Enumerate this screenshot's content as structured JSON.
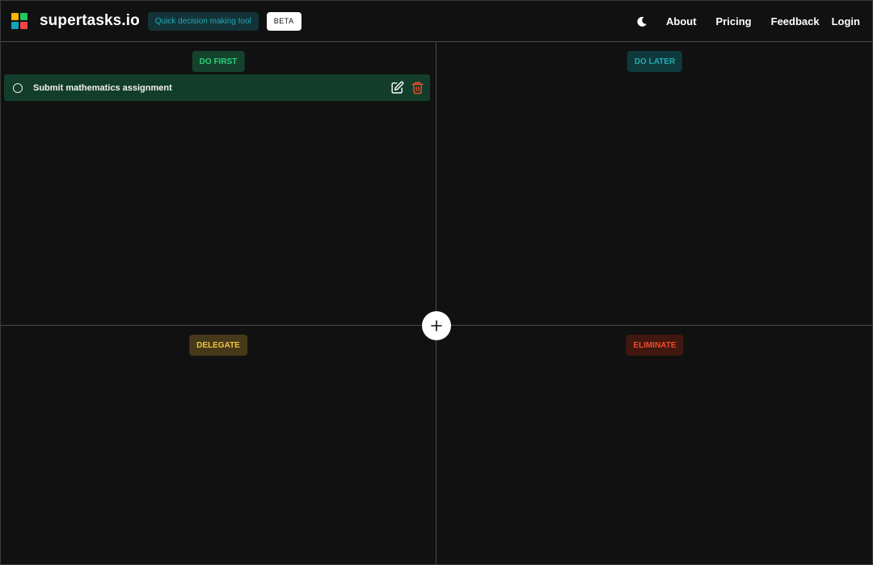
{
  "header": {
    "brand": "supertasks.io",
    "tagline": "Quick decision making tool",
    "beta_badge": "BETA",
    "logo_colors": [
      "#f4b400",
      "#22c55e",
      "#0ea5b7",
      "#ef4444"
    ]
  },
  "nav": {
    "theme_toggle_icon": "moon-icon",
    "about": "About",
    "pricing": "Pricing",
    "feedback": "Feedback",
    "login": "Login"
  },
  "quadrants": {
    "do_first": {
      "label": "DO FIRST",
      "color": "#2bd27a"
    },
    "do_later": {
      "label": "DO LATER",
      "color": "#26a9b4"
    },
    "delegate": {
      "label": "DELEGATE",
      "color": "#f1c23a"
    },
    "eliminate": {
      "label": "ELIMINATE",
      "color": "#ef4c2b"
    }
  },
  "tasks": {
    "do_first": [
      {
        "text": "Submit mathematics assignment",
        "edit_icon": "edit-icon",
        "delete_icon": "trash-icon"
      }
    ]
  },
  "add_button": {
    "icon": "plus-icon"
  }
}
